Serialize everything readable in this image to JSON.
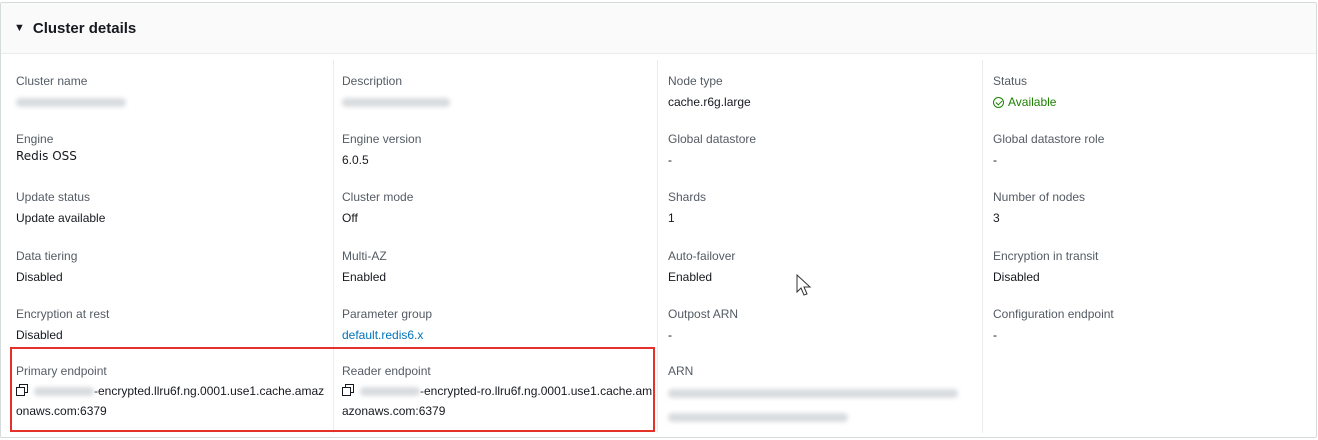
{
  "panel": {
    "title": "Cluster details"
  },
  "columns": [
    [
      {
        "label": "Cluster name",
        "value": "",
        "redacted": true
      },
      {
        "label": "Engine",
        "value": "Redis OSS"
      },
      {
        "label": "Update status",
        "value": "Update available"
      },
      {
        "label": "Data tiering",
        "value": "Disabled"
      },
      {
        "label": "Encryption at rest",
        "value": "Disabled"
      },
      {
        "label": "Primary endpoint",
        "value_suffix": "-encrypted.llru6f.ng.0001.use1.cache.amazonaws.com:6379"
      }
    ],
    [
      {
        "label": "Description",
        "value": "",
        "redacted": true
      },
      {
        "label": "Engine version",
        "value": "6.0.5"
      },
      {
        "label": "Cluster mode",
        "value": "Off"
      },
      {
        "label": "Multi-AZ",
        "value": "Enabled"
      },
      {
        "label": "Parameter group",
        "value": "default.redis6.x"
      },
      {
        "label": "Reader endpoint",
        "value_suffix": "-encrypted-ro.llru6f.ng.0001.use1.cache.amazonaws.com:6379"
      }
    ],
    [
      {
        "label": "Node type",
        "value": "cache.r6g.large"
      },
      {
        "label": "Global datastore",
        "value": "-"
      },
      {
        "label": "Shards",
        "value": "1"
      },
      {
        "label": "Auto-failover",
        "value": "Enabled"
      },
      {
        "label": "Outpost ARN",
        "value": "-"
      },
      {
        "label": "ARN",
        "value": "",
        "redacted": true
      }
    ],
    [
      {
        "label": "Status",
        "value": "Available"
      },
      {
        "label": "Global datastore role",
        "value": "-"
      },
      {
        "label": "Number of nodes",
        "value": "3"
      },
      {
        "label": "Encryption in transit",
        "value": "Disabled"
      },
      {
        "label": "Configuration endpoint",
        "value": "-"
      }
    ]
  ],
  "colors": {
    "accent_link": "#0073bb",
    "status_ok": "#1d8102",
    "highlight": "#e4322b"
  },
  "icons": {
    "panel_toggle": "caret-down-icon",
    "status": "check-circle-icon",
    "copy": "copy-icon"
  }
}
